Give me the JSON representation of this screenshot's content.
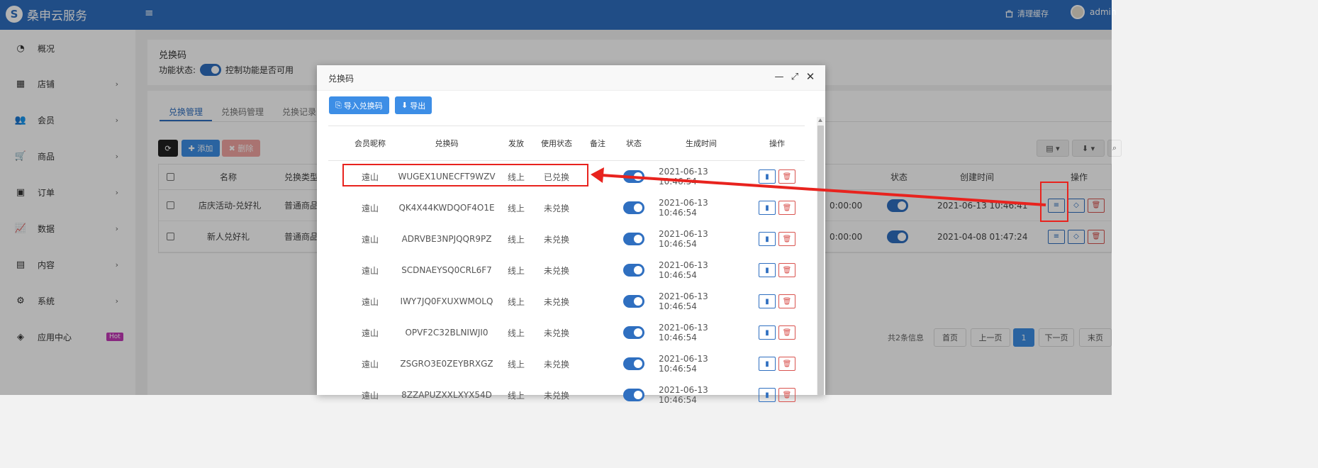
{
  "app": {
    "brand": "桑申云服务",
    "brand_mark": "S",
    "menu_toggle_icon": "≡",
    "clear_cache": "清理缓存",
    "user": "admin"
  },
  "sidebar": {
    "items": [
      {
        "label": "概况",
        "icon": "dashboard-icon",
        "glyph": "◔",
        "arrow": false
      },
      {
        "label": "店铺",
        "icon": "grid-icon",
        "glyph": "▦",
        "arrow": true
      },
      {
        "label": "会员",
        "icon": "users-icon",
        "glyph": "👥",
        "arrow": true
      },
      {
        "label": "商品",
        "icon": "cart-icon",
        "glyph": "🛒",
        "arrow": true
      },
      {
        "label": "订单",
        "icon": "money-icon",
        "glyph": "▣",
        "arrow": true
      },
      {
        "label": "数据",
        "icon": "chart-line-icon",
        "glyph": "📈",
        "arrow": true
      },
      {
        "label": "内容",
        "icon": "file-icon",
        "glyph": "▤",
        "arrow": true
      },
      {
        "label": "系统",
        "icon": "gear-icon",
        "glyph": "⚙",
        "arrow": true
      },
      {
        "label": "应用中心",
        "icon": "cube-icon",
        "glyph": "◈",
        "arrow": false,
        "badge": "Hot"
      }
    ]
  },
  "page": {
    "title": "兑换码",
    "status_label": "功能状态:",
    "status_hint": "控制功能是否可用",
    "tabs": [
      "兑换管理",
      "兑换码管理",
      "兑换记录"
    ],
    "add_label": "添加",
    "delete_label": "删除",
    "table_headers": {
      "name": "名称",
      "type": "兑换类型",
      "status": "状态",
      "created": "创建时间",
      "actions": "操作"
    },
    "rows": [
      {
        "name": "店庆活动-兑好礼",
        "type": "普通商品",
        "time_tail": "0:00:00",
        "created": "2021-06-13 10:46:41"
      },
      {
        "name": "新人兑好礼",
        "type": "普通商品",
        "time_tail": "0:00:00",
        "created": "2021-04-08 01:47:24"
      }
    ],
    "pager": {
      "total": "共2条信息",
      "first": "首页",
      "prev": "上一页",
      "current": "1",
      "next": "下一页",
      "last": "末页"
    }
  },
  "modal": {
    "title": "兑换码",
    "import_label": "导入兑换码",
    "export_label": "导出",
    "headers": {
      "nickname": "会员昵称",
      "code": "兑换码",
      "issue": "发放",
      "use_status": "使用状态",
      "note": "备注",
      "status": "状态",
      "created": "生成时间",
      "actions": "操作"
    },
    "rows": [
      {
        "nickname": "遠山",
        "code": "WUGEX1UNECFT9WZV",
        "issue": "线上",
        "use_status": "已兑换",
        "note": "",
        "created": "2021-06-13 10:46:54"
      },
      {
        "nickname": "遠山",
        "code": "QK4X44KWDQOF4O1E",
        "issue": "线上",
        "use_status": "未兑换",
        "note": "",
        "created": "2021-06-13 10:46:54"
      },
      {
        "nickname": "遠山",
        "code": "ADRVBE3NPJQQR9PZ",
        "issue": "线上",
        "use_status": "未兑换",
        "note": "",
        "created": "2021-06-13 10:46:54"
      },
      {
        "nickname": "遠山",
        "code": "SCDNAEYSQ0CRL6F7",
        "issue": "线上",
        "use_status": "未兑换",
        "note": "",
        "created": "2021-06-13 10:46:54"
      },
      {
        "nickname": "遠山",
        "code": "IWY7JQ0FXUXWMOLQ",
        "issue": "线上",
        "use_status": "未兑换",
        "note": "",
        "created": "2021-06-13 10:46:54"
      },
      {
        "nickname": "遠山",
        "code": "OPVF2C32BLNIWJI0",
        "issue": "线上",
        "use_status": "未兑换",
        "note": "",
        "created": "2021-06-13 10:46:54"
      },
      {
        "nickname": "遠山",
        "code": "ZSGRO3E0ZEYBRXGZ",
        "issue": "线上",
        "use_status": "未兑换",
        "note": "",
        "created": "2021-06-13 10:46:54"
      },
      {
        "nickname": "遠山",
        "code": "8ZZAPUZXXLXYX54D",
        "issue": "线上",
        "use_status": "未兑换",
        "note": "",
        "created": "2021-06-13 10:46:54"
      }
    ]
  },
  "colors": {
    "brand": "#2f6fc0",
    "annotation": "#e8231e",
    "danger": "#d9534f"
  }
}
